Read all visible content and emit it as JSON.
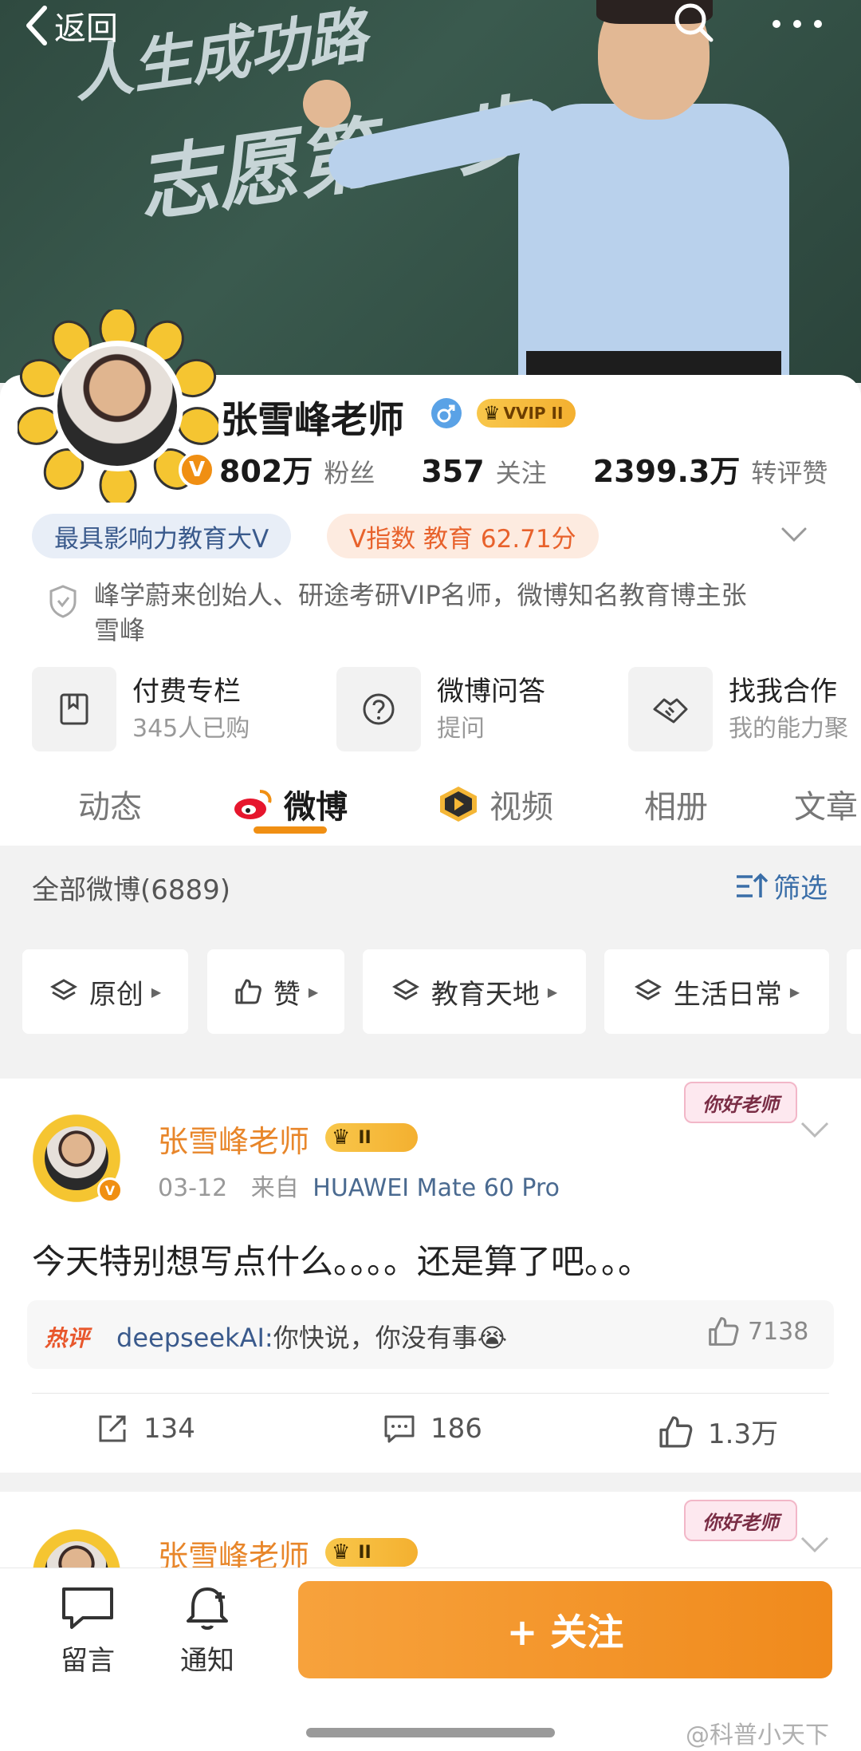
{
  "header": {
    "back_label": "返回",
    "banner_line1": "人生成功路",
    "banner_line2": "志愿第一步"
  },
  "profile": {
    "name": "张雪峰老师",
    "vip_badge": "VVIP II",
    "verified_badge": "V",
    "stats": [
      {
        "value": "802万",
        "label": "粉丝"
      },
      {
        "value": "357",
        "label": "关注"
      },
      {
        "value": "2399.3万",
        "label": "转评赞"
      }
    ],
    "tags": {
      "influence": "最具影响力教育大V",
      "v_index": "V指数 教育 62.71分"
    },
    "bio": "峰学蔚来创始人、研途考研VIP名师，微博知名教育博主张雪峰",
    "features": [
      {
        "title": "付费专栏",
        "sub": "345人已购"
      },
      {
        "title": "微博问答",
        "sub": "提问"
      },
      {
        "title": "找我合作",
        "sub": "我的能力聚"
      }
    ]
  },
  "tabs": [
    "动态",
    "微博",
    "视频",
    "相册",
    "文章"
  ],
  "active_tab": "微博",
  "feed": {
    "all_count": "全部微博(6889)",
    "filter_label": "筛选",
    "chips": [
      "原创",
      "赞",
      "教育天地",
      "生活日常"
    ]
  },
  "posts": [
    {
      "author": "张雪峰老师",
      "rank_badge": "II",
      "sticker": "你好老师",
      "date": "03-12",
      "source_prefix": "来自",
      "device": "HUAWEI Mate 60 Pro",
      "body": "今天特别想写点什么。。。。还是算了吧。。。",
      "hot_label": "热评",
      "hot_author": "deepseekAI:",
      "hot_text": "你快说，你没有事😭",
      "hot_likes": "7138",
      "reposts": "134",
      "comments": "186",
      "likes": "1.3万"
    },
    {
      "author": "张雪峰老师",
      "rank_badge": "II",
      "sticker": "你好老师"
    }
  ],
  "bottom": {
    "message_label": "留言",
    "notify_label": "通知",
    "follow_label": "+ 关注"
  },
  "watermark": "@科普小天下",
  "colors": {
    "accent": "#f08f13",
    "link": "#3a6ea8",
    "author": "#e8862a"
  }
}
